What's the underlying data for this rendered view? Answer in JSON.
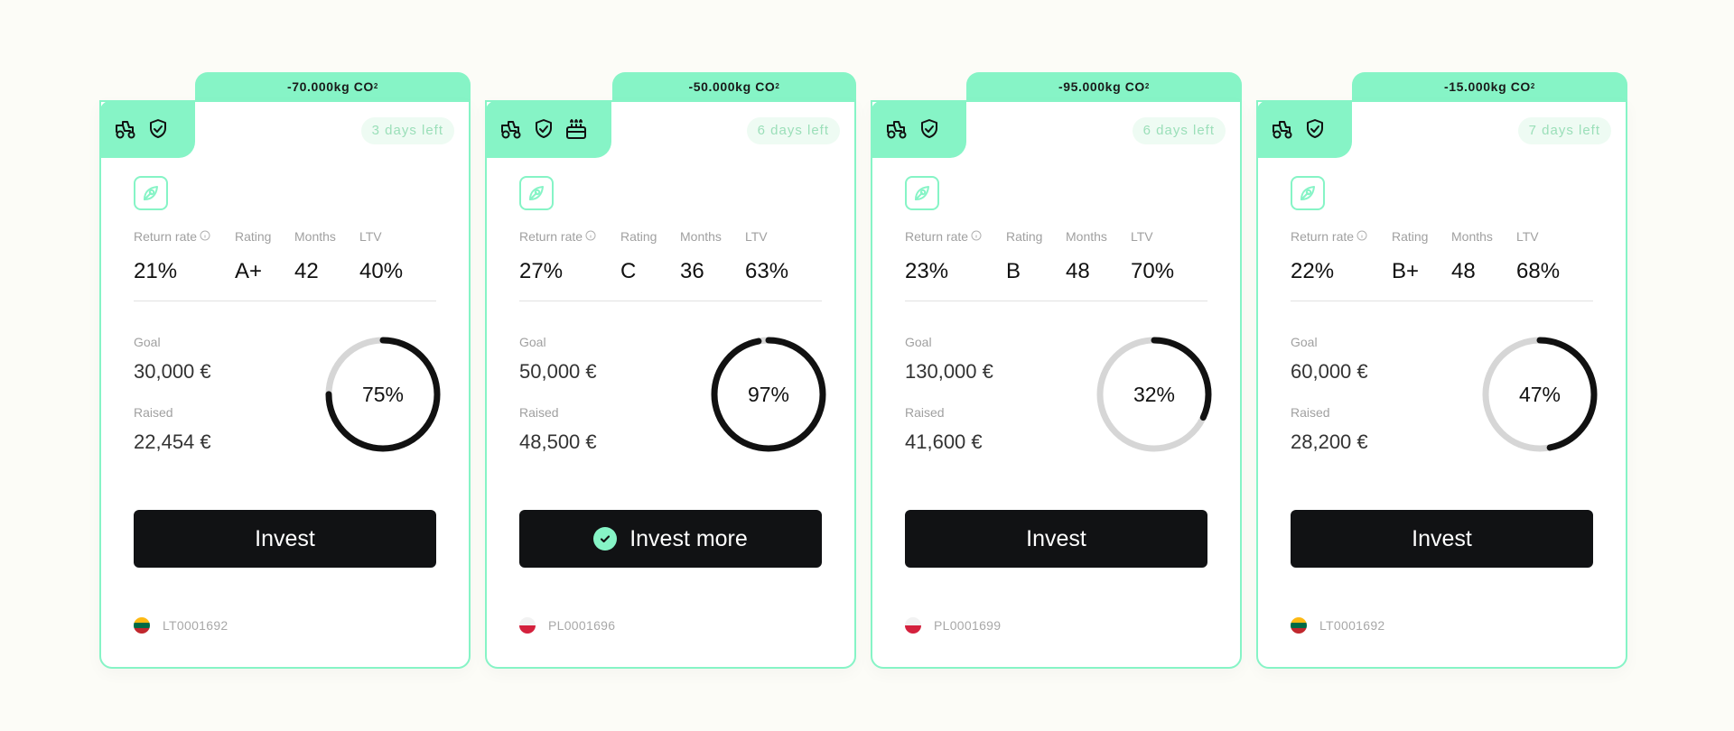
{
  "colors": {
    "accent": "#86f4c6",
    "button": "#111214",
    "ring_track": "#d6d6d6",
    "ring_fill": "#111111"
  },
  "cards": [
    {
      "co2": "-70.000kg CO",
      "co2_sub": "2",
      "icons": [
        "tractor-icon",
        "shield-check-icon"
      ],
      "days_left": "3 days left",
      "stats": [
        {
          "label": "Return rate",
          "value": "21%"
        },
        {
          "label": "Rating",
          "value": "A+"
        },
        {
          "label": "Months",
          "value": "42"
        },
        {
          "label": "LTV",
          "value": "40%"
        }
      ],
      "goal_label": "Goal",
      "goal": "30,000 €",
      "raised_label": "Raised",
      "raised": "22,454 €",
      "progress_label": "75%",
      "progress": 0.75,
      "button_label": "Invest",
      "invested": false,
      "country": "LT",
      "loan_id": "LT0001692"
    },
    {
      "co2": "-50.000kg CO",
      "co2_sub": "2",
      "icons": [
        "tractor-icon",
        "shield-check-icon",
        "gift-icon"
      ],
      "days_left": "6 days left",
      "stats": [
        {
          "label": "Return rate",
          "value": "27%"
        },
        {
          "label": "Rating",
          "value": "C"
        },
        {
          "label": "Months",
          "value": "36"
        },
        {
          "label": "LTV",
          "value": "63%"
        }
      ],
      "goal_label": "Goal",
      "goal": "50,000 €",
      "raised_label": "Raised",
      "raised": "48,500 €",
      "progress_label": "97%",
      "progress": 0.97,
      "button_label": "Invest more",
      "invested": true,
      "country": "PL",
      "loan_id": "PL0001696"
    },
    {
      "co2": "-95.000kg CO",
      "co2_sub": "2",
      "icons": [
        "tractor-icon",
        "shield-check-icon"
      ],
      "days_left": "6 days left",
      "stats": [
        {
          "label": "Return rate",
          "value": "23%"
        },
        {
          "label": "Rating",
          "value": "B"
        },
        {
          "label": "Months",
          "value": "48"
        },
        {
          "label": "LTV",
          "value": "70%"
        }
      ],
      "goal_label": "Goal",
      "goal": "130,000 €",
      "raised_label": "Raised",
      "raised": "41,600 €",
      "progress_label": "32%",
      "progress": 0.32,
      "button_label": "Invest",
      "invested": false,
      "country": "PL",
      "loan_id": "PL0001699"
    },
    {
      "co2": "-15.000kg CO",
      "co2_sub": "2",
      "icons": [
        "tractor-icon",
        "shield-check-icon"
      ],
      "days_left": "7 days left",
      "stats": [
        {
          "label": "Return rate",
          "value": "22%"
        },
        {
          "label": "Rating",
          "value": "B+"
        },
        {
          "label": "Months",
          "value": "48"
        },
        {
          "label": "LTV",
          "value": "68%"
        }
      ],
      "goal_label": "Goal",
      "goal": "60,000 €",
      "raised_label": "Raised",
      "raised": "28,200 €",
      "progress_label": "47%",
      "progress": 0.47,
      "button_label": "Invest",
      "invested": false,
      "country": "LT",
      "loan_id": "LT0001692"
    }
  ]
}
